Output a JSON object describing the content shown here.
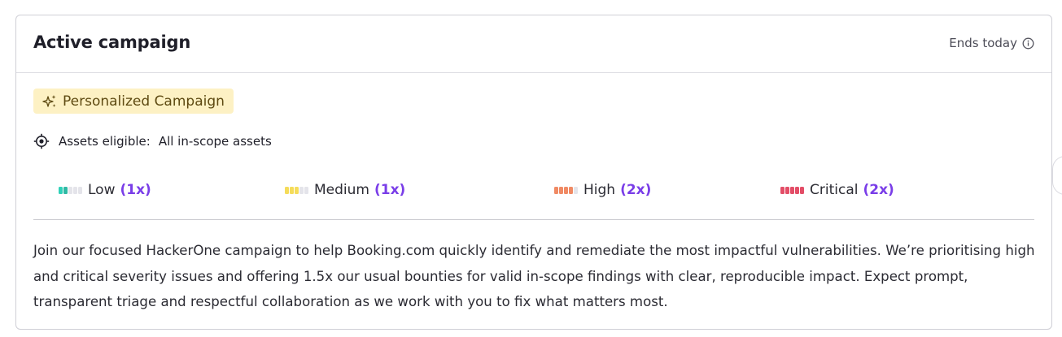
{
  "card": {
    "title": "Active campaign",
    "ends_label": "Ends today",
    "ends_icon": "info-icon"
  },
  "badge": {
    "icon": "sparkle-icon",
    "label": "Personalized Campaign",
    "color": "#fdf1c4"
  },
  "assets": {
    "icon": "target-icon",
    "label": "Assets eligible:",
    "value": "All in-scope assets"
  },
  "severities": [
    {
      "label": "Low",
      "multiplier": "(1x)",
      "color": "#2fd1b8",
      "filled": 2
    },
    {
      "label": "Medium",
      "multiplier": "(1x)",
      "color": "#f5dc5a",
      "filled": 3
    },
    {
      "label": "High",
      "multiplier": "(2x)",
      "color": "#f08a64",
      "filled": 4
    },
    {
      "label": "Critical",
      "multiplier": "(2x)",
      "color": "#e34d67",
      "filled": 5
    }
  ],
  "description": "Join our focused HackerOne campaign to help Booking.com quickly identify and remediate the most impactful vulnerabilities. We’re prioritising high and critical severity issues and offering 1.5x our usual bounties for valid in-scope findings with clear, reproducible impact. Expect prompt, transparent triage and respectful collaboration as we work with you to fix what matters most.",
  "accent_color": "#7a3ee8"
}
